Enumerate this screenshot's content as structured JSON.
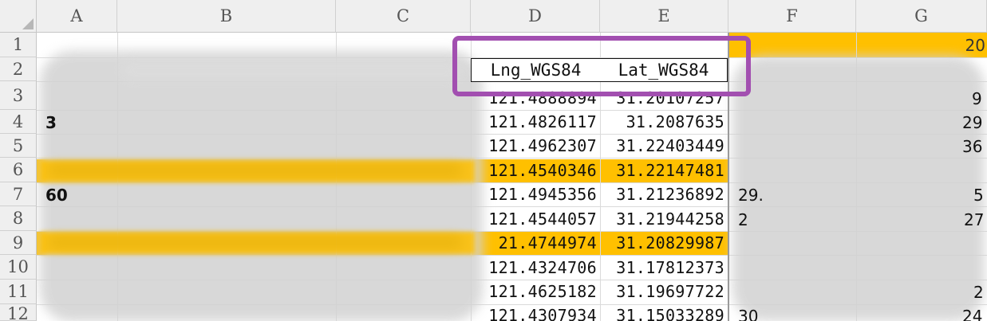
{
  "columns": [
    "A",
    "B",
    "C",
    "D",
    "E",
    "F",
    "G"
  ],
  "rows": [
    "1",
    "2",
    "3",
    "4",
    "5",
    "6",
    "7",
    "8",
    "9",
    "10",
    "11",
    "12"
  ],
  "headers": {
    "lng": "Lng_WGS84",
    "lat": "Lat_WGS84"
  },
  "g1_text": "20",
  "lng_values": [
    "121.4888894",
    "121.4826117",
    "121.4962307",
    "121.4540346",
    "121.4945356",
    "121.4544057",
    "21.4744974",
    "121.4324706",
    "121.4625182",
    "121.4307934"
  ],
  "lat_values": [
    "31.20107257",
    "31.2087635",
    "31.22403449",
    "31.22147481",
    "31.21236892",
    "31.21944258",
    "31.20829987",
    "31.17812373",
    "31.19697722",
    "31.15033289"
  ],
  "fragments": {
    "a4": "3",
    "a7": "60",
    "g3": "9",
    "g4": "29",
    "g5": "36",
    "f7": "29.",
    "g7": "5",
    "f8": "2",
    "g8": "27",
    "g11": "2",
    "f12": "30",
    "g12": "24"
  },
  "colors": {
    "highlight": "#ffc000",
    "selection": "#a24fb0"
  }
}
